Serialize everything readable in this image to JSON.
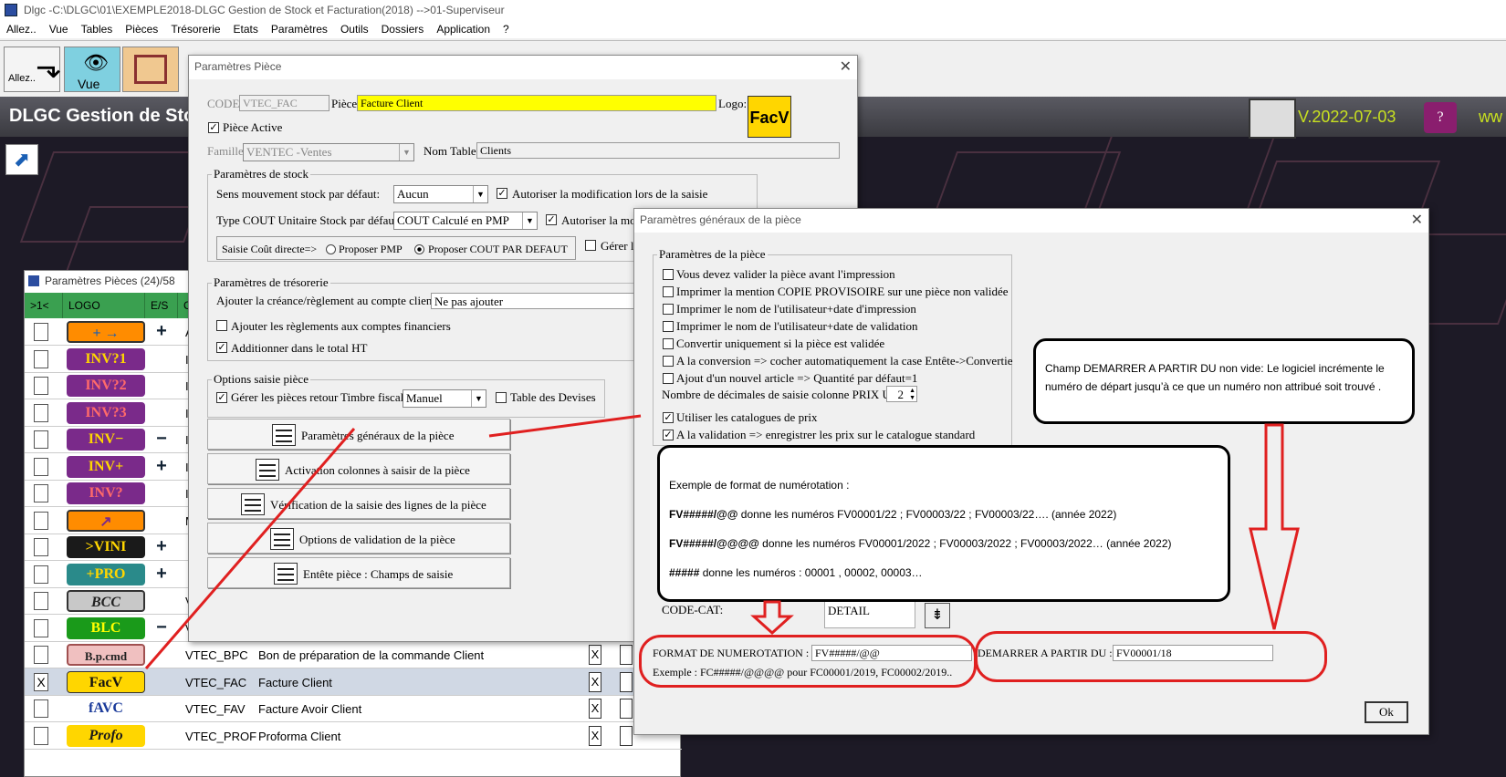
{
  "app": {
    "title": "Dlgc -C:\\DLGC\\01\\EXEMPLE2018-DLGC Gestion de Stock et Facturation(2018) -->01-Superviseur",
    "menu": [
      "Allez..",
      "Vue",
      "Tables",
      "Pièces",
      "Trésorerie",
      "Etats",
      "Paramètres",
      "Outils",
      "Dossiers",
      "Application",
      "?"
    ],
    "toolbar": {
      "allez": "Allez..",
      "vue": "Vue"
    },
    "banner_title": "DLGC Gestion de Stoc",
    "version": "V.2022-07-03",
    "www": "ww"
  },
  "list": {
    "title": "Paramètres Pièces (24)/58",
    "headers": [
      ">1<",
      "LOGO",
      "E/S",
      "CO"
    ],
    "rows": [
      {
        "logo": "+ →",
        "es": "+",
        "code": "A",
        "desc": "",
        "checked": ""
      },
      {
        "logo": "INV?1",
        "es": "",
        "code": "IN",
        "desc": "",
        "checked": ""
      },
      {
        "logo": "INV?2",
        "es": "",
        "code": "IN",
        "desc": "",
        "checked": ""
      },
      {
        "logo": "INV?3",
        "es": "",
        "code": "IN",
        "desc": "",
        "checked": ""
      },
      {
        "logo": "INV−",
        "es": "−",
        "code": "IN",
        "desc": "",
        "checked": ""
      },
      {
        "logo": "INV+",
        "es": "+",
        "code": "IN",
        "desc": "",
        "checked": ""
      },
      {
        "logo": "INV?",
        "es": "",
        "code": "IN",
        "desc": "",
        "checked": ""
      },
      {
        "logo": "↗",
        "es": "",
        "code": "M",
        "desc": "",
        "checked": ""
      },
      {
        "logo": ">VINI",
        "es": "+",
        "code": "",
        "desc": "",
        "checked": ""
      },
      {
        "logo": "+PRO",
        "es": "+",
        "code": "",
        "desc": "",
        "checked": ""
      },
      {
        "logo": "BCC",
        "es": "",
        "code": "V",
        "desc": "",
        "checked": ""
      },
      {
        "logo": "BLC",
        "es": "−",
        "code": "V",
        "desc": "",
        "checked": ""
      },
      {
        "logo": "B.p.cmd",
        "es": "",
        "code": "VTEC_BPC",
        "desc": "Bon de préparation de la commande Client",
        "checked": ""
      },
      {
        "logo": "FacV",
        "es": "",
        "code": "VTEC_FAC",
        "desc": "Facture Client",
        "checked": "X"
      },
      {
        "logo": "fAVC",
        "es": "",
        "code": "VTEC_FAV",
        "desc": "Facture Avoir Client",
        "checked": ""
      },
      {
        "logo": "Profo",
        "es": "",
        "code": "VTEC_PROF",
        "desc": "Proforma Client",
        "checked": ""
      }
    ]
  },
  "dlg1": {
    "title": "Paramètres Pièce",
    "code_label": "CODE:",
    "code_value": "VTEC_FAC",
    "piece_label": "Pièce:",
    "piece_value": "Facture Client",
    "logo_label": "Logo:",
    "logo_text": "FacV",
    "piece_active": "Pièce Active",
    "famille_label": "Famille:",
    "famille_value": "VENTEC   -Ventes",
    "nom_table_label": "Nom Table:",
    "nom_table_value": "Clients",
    "stock": {
      "title": "Paramètres de stock",
      "sens_label": "Sens mouvement stock par défaut:",
      "sens_value": "Aucun",
      "autoriser1": "Autoriser la modification lors de la saisie",
      "type_cout_label": "Type COUT Unitaire Stock par défaut:",
      "type_cout_value": "COUT Calculé en PMP",
      "autoriser2": "Autoriser la mod",
      "saisie_cout": "Saisie Coût directe=>",
      "proposer_pmp": "Proposer PMP",
      "proposer_cout": "Proposer COUT PAR DEFAUT",
      "gerer": "Gérer le"
    },
    "tresorerie": {
      "title": "Paramètres de trésorerie",
      "ajouter_label": "Ajouter la créance/règlement au compte client:",
      "ajouter_value": "Ne pas ajouter",
      "ajouter_reglements": "Ajouter les règlements aux comptes financiers",
      "additionner": "Additionner dans le total HT"
    },
    "options": {
      "title": "Options saisie pièce",
      "gerer_retour": "Gérer les pièces retour",
      "timbre_label": "Timbre fiscal:",
      "timbre_value": "Manuel",
      "table_devises": "Table des Devises"
    },
    "buttons": [
      "Paramètres généraux de la pièce",
      "Activation colonnes à saisir de la pièce",
      "Vérification  de la saisie des lignes de la pièce",
      "Options de validation de la pièce",
      "Entête pièce : Champs de saisie"
    ]
  },
  "dlg2": {
    "title": "Paramètres généraux de la pièce",
    "group_title": "Paramètres de la pièce",
    "checks": [
      {
        "label": "Vous devez valider la pièce avant l'impression",
        "checked": ""
      },
      {
        "label": "Imprimer la mention COPIE PROVISOIRE sur une pièce non validée",
        "checked": ""
      },
      {
        "label": "Imprimer le nom de l'utilisateur+date d'impression",
        "checked": ""
      },
      {
        "label": "Imprimer le nom de l'utilisateur+date de validation",
        "checked": ""
      },
      {
        "label": "Convertir uniquement si la pièce est validée",
        "checked": ""
      },
      {
        "label": "A la conversion => cocher automatiquement la case Entête->Convertie",
        "checked": ""
      },
      {
        "label": "Ajout d'un nouvel article => Quantité par défaut=1",
        "checked": ""
      }
    ],
    "decimales_label": "Nombre de décimales de saisie colonne PRIX U.:",
    "decimales_value": "2",
    "utiliser_catalogues": "Utiliser les catalogues de prix",
    "a_la_validation": "A la validation => enregistrer les prix sur le catalogue standard",
    "code_cat_label": "CODE-CAT:",
    "code_cat_value": "DETAIL",
    "format_label": "FORMAT DE NUMEROTATION :",
    "format_value": "FV#####/@@",
    "exemple": "Exemple : FC#####/@@@@ pour FC00001/2019, FC00002/2019..",
    "demarrer_label": "DEMARRER A PARTIR DU :",
    "demarrer_value": "FV00001/18",
    "ok": "Ok"
  },
  "callouts": {
    "demarrer": "Champ DEMARRER A PARTIR DU non  vide: Le logiciel incrémente le numéro de départ  jusqu’à ce que un  numéro non attribué soit trouvé .",
    "format_title": "Exemple de format de numérotation :",
    "format_lines": [
      {
        "bold": "FV#####/@@",
        "text": " donne les numéros FV00001/22 ; FV00003/22 ; FV00003/22….  (année 2022)"
      },
      {
        "bold": "FV#####/@@@@",
        "text": " donne les numéros FV00001/2022 ; FV00003/2022 ; FV00003/2022… (année 2022)"
      },
      {
        "bold": "#####",
        "text": " donne les numéros : 00001 , 00002, 00003…"
      }
    ]
  },
  "colors": {
    "highlight": "#ffff00",
    "list_header": "#3aa050",
    "annotation_red": "#e02020",
    "version": "#c8e020"
  }
}
